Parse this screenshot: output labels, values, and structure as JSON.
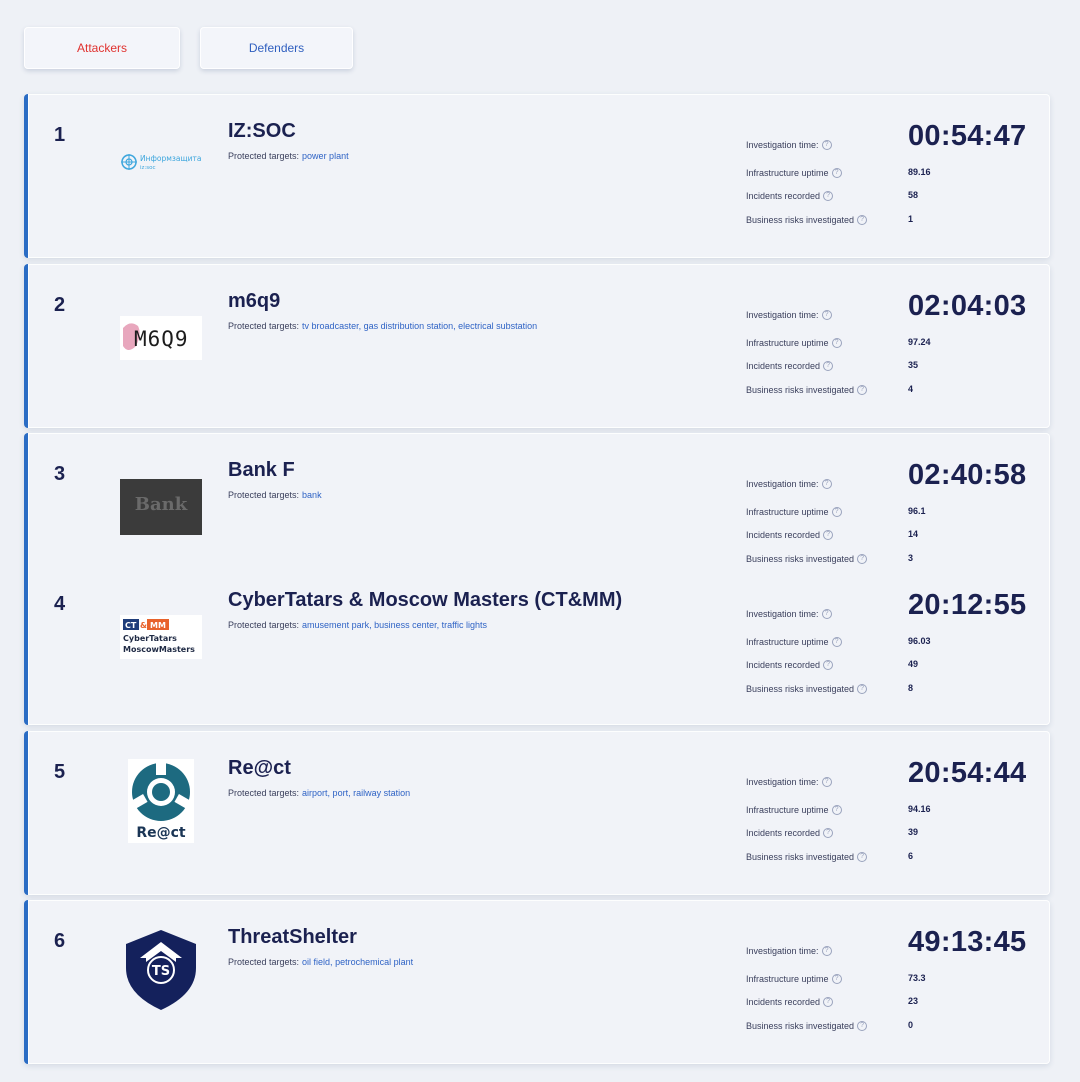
{
  "tabs": {
    "attackers": "Attackers",
    "defenders": "Defenders"
  },
  "labels": {
    "protected_targets": "Protected targets:",
    "investigation_time": "Investigation time:",
    "infrastructure_uptime": "Infrastructure uptime",
    "incidents_recorded": "Incidents recorded",
    "business_risks": "Business risks investigated",
    "help_glyph": "?"
  },
  "colors": {
    "accent": "#2a6cc4",
    "attackers": "#e0322f",
    "defenders": "#2f5fbf",
    "text": "#1b2150",
    "link": "#2f63c5"
  },
  "teams": [
    {
      "rank": "1",
      "name": "IZ:SOC",
      "logo": "infozashchita-logo",
      "logo_text": [
        "Информзащита",
        "iz:soc"
      ],
      "targets": "power plant",
      "time": "00:54:47",
      "uptime": "89.16",
      "incidents": "58",
      "risks": "1"
    },
    {
      "rank": "2",
      "name": "m6q9",
      "logo": "m6q9-logo",
      "logo_text": [
        "M6Q9"
      ],
      "targets": "tv broadcaster, gas distribution station, electrical substation",
      "time": "02:04:03",
      "uptime": "97.24",
      "incidents": "35",
      "risks": "4"
    },
    {
      "rank": "3",
      "name": "Bank F",
      "logo": "bank-f-logo",
      "logo_text": [
        "Bank"
      ],
      "targets": "bank",
      "time": "02:40:58",
      "uptime": "96.1",
      "incidents": "14",
      "risks": "3"
    },
    {
      "rank": "4",
      "name": "CyberTatars & Moscow Masters (CT&MM)",
      "logo": "ctmm-logo",
      "logo_text": [
        "CT",
        "MM",
        "CyberTatars",
        "MoscowMasters"
      ],
      "targets": "amusement park, business center, traffic lights",
      "time": "20:12:55",
      "uptime": "96.03",
      "incidents": "49",
      "risks": "8"
    },
    {
      "rank": "5",
      "name": "Re@ct",
      "logo": "react-logo",
      "logo_text": [
        "Re@ct"
      ],
      "targets": "airport, port, railway station",
      "time": "20:54:44",
      "uptime": "94.16",
      "incidents": "39",
      "risks": "6"
    },
    {
      "rank": "6",
      "name": "ThreatShelter",
      "logo": "threatshelter-shield-logo",
      "logo_text": [
        "TS"
      ],
      "targets": "oil field, petrochemical plant",
      "time": "49:13:45",
      "uptime": "73.3",
      "incidents": "23",
      "risks": "0"
    }
  ]
}
